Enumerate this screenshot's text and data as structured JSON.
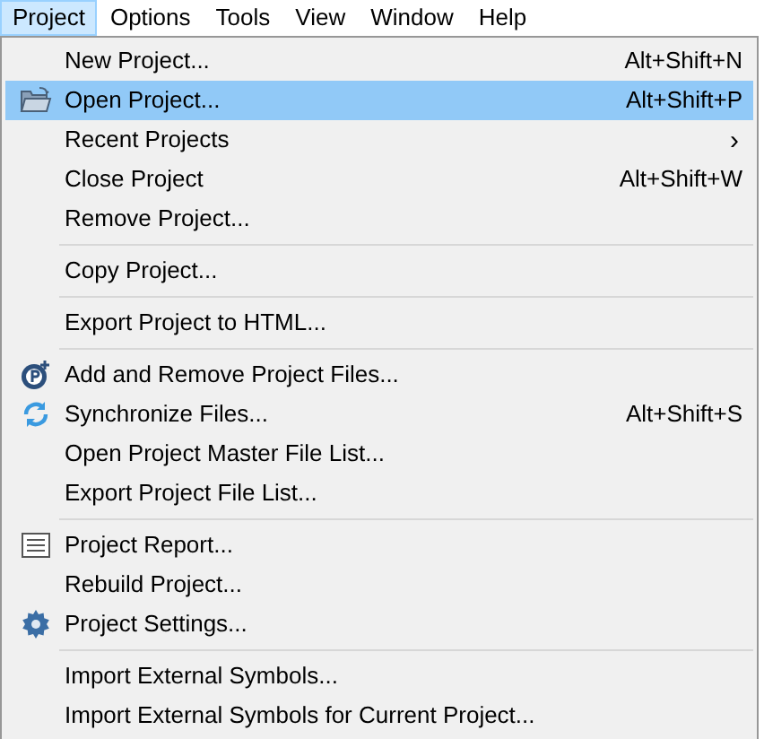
{
  "menubar": [
    {
      "label": "Project",
      "selected": true
    },
    {
      "label": "Options",
      "selected": false
    },
    {
      "label": "Tools",
      "selected": false
    },
    {
      "label": "View",
      "selected": false
    },
    {
      "label": "Window",
      "selected": false
    },
    {
      "label": "Help",
      "selected": false
    }
  ],
  "menu": {
    "sections": [
      [
        {
          "label": "New Project...",
          "shortcut": "Alt+Shift+N",
          "selected": false
        },
        {
          "label": "Open Project...",
          "shortcut": "Alt+Shift+P",
          "selected": true
        },
        {
          "label": "Recent Projects",
          "arrow": "›",
          "selected": false
        },
        {
          "label": "Close Project",
          "shortcut": "Alt+Shift+W",
          "selected": false
        },
        {
          "label": "Remove Project...",
          "selected": false
        }
      ],
      [
        {
          "label": "Copy Project...",
          "selected": false
        }
      ],
      [
        {
          "label": "Export Project to HTML...",
          "selected": false
        }
      ],
      [
        {
          "label": "Add and Remove Project Files...",
          "selected": false
        },
        {
          "label": "Synchronize Files...",
          "shortcut": "Alt+Shift+S",
          "selected": false
        },
        {
          "label": "Open Project Master File List...",
          "selected": false
        },
        {
          "label": "Export Project File List...",
          "selected": false
        }
      ],
      [
        {
          "label": "Project Report...",
          "selected": false
        },
        {
          "label": "Rebuild Project...",
          "selected": false
        },
        {
          "label": "Project Settings...",
          "selected": false
        }
      ],
      [
        {
          "label": "Import External Symbols...",
          "selected": false
        },
        {
          "label": "Import External Symbols for Current Project...",
          "selected": false
        }
      ]
    ]
  }
}
